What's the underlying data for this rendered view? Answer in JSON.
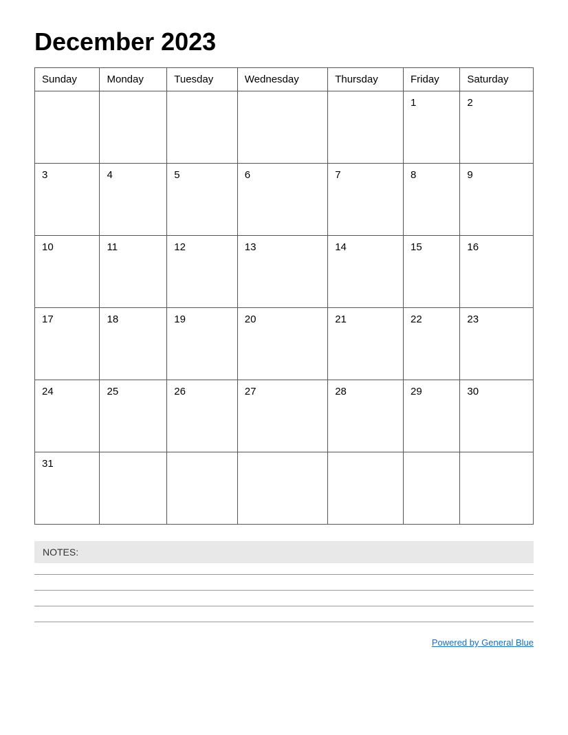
{
  "header": {
    "title": "December 2023"
  },
  "calendar": {
    "days_of_week": [
      "Sunday",
      "Monday",
      "Tuesday",
      "Wednesday",
      "Thursday",
      "Friday",
      "Saturday"
    ],
    "weeks": [
      [
        null,
        null,
        null,
        null,
        null,
        1,
        2
      ],
      [
        3,
        4,
        5,
        6,
        7,
        8,
        9
      ],
      [
        10,
        11,
        12,
        13,
        14,
        15,
        16
      ],
      [
        17,
        18,
        19,
        20,
        21,
        22,
        23
      ],
      [
        24,
        25,
        26,
        27,
        28,
        29,
        30
      ],
      [
        31,
        null,
        null,
        null,
        null,
        null,
        null
      ]
    ]
  },
  "notes": {
    "label": "NOTES:",
    "lines": 4
  },
  "footer": {
    "powered_by_text": "Powered by General Blue",
    "powered_by_url": "#"
  }
}
